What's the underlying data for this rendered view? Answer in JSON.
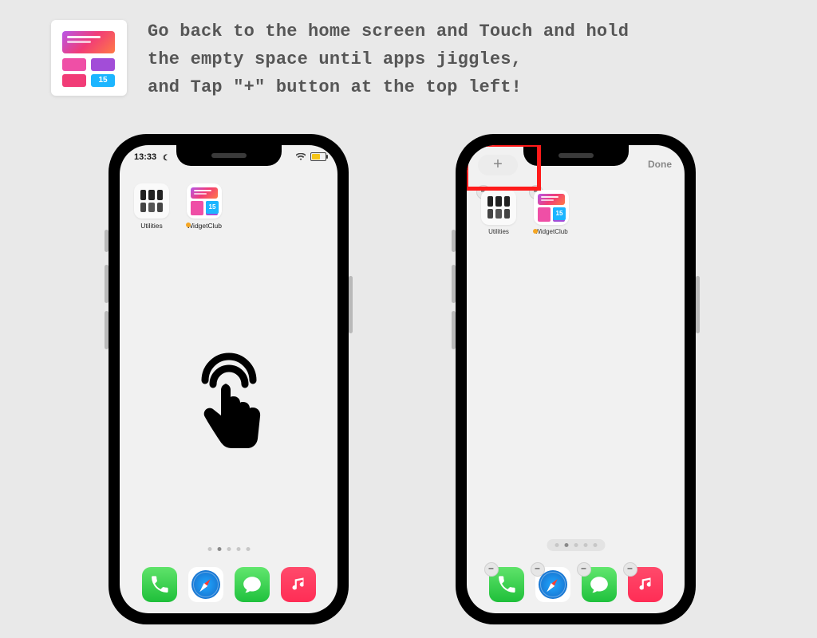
{
  "headline": {
    "line1": "Go back to the home screen and Touch and hold",
    "line2": "the empty space until apps jiggles,",
    "line3": "and Tap \"+\" button at the top left!"
  },
  "app_tile": {
    "cal_text": "15"
  },
  "phones": {
    "left": {
      "time": "13:33",
      "apps": [
        {
          "label": "Utilities"
        },
        {
          "label": "WidgetClub",
          "badge": "15"
        }
      ]
    },
    "right": {
      "add_label": "+",
      "done_label": "Done",
      "apps": [
        {
          "label": "Utilities"
        },
        {
          "label": "WidgetClub",
          "badge": "15"
        }
      ]
    }
  },
  "dock_icons": [
    "phone",
    "safari",
    "messages",
    "music"
  ]
}
